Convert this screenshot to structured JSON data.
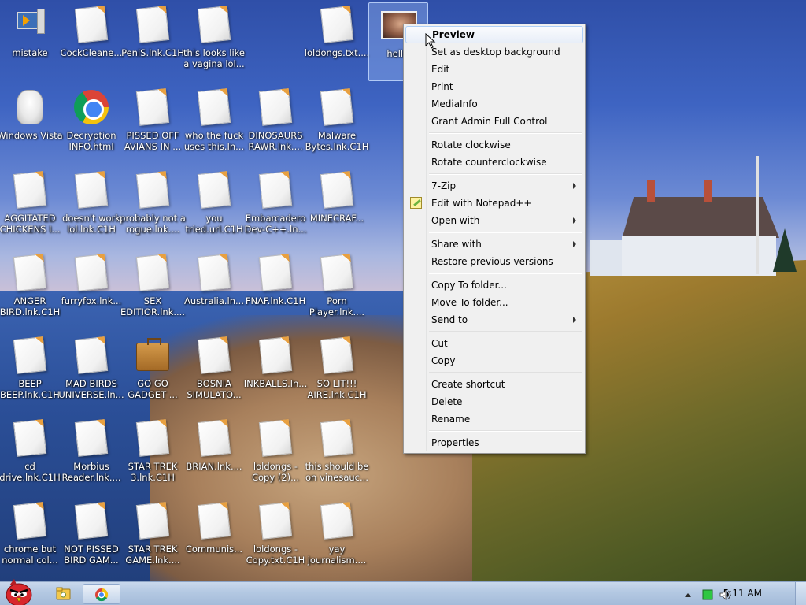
{
  "desktop": {
    "icons": [
      {
        "label": "mistake",
        "icon": "computer-arrow-icon"
      },
      {
        "label": "CockCleane...",
        "icon": "document-icon"
      },
      {
        "label": "PeniS.lnk.C1H",
        "icon": "document-icon"
      },
      {
        "label": "this looks like a vagina lol...",
        "icon": "document-icon"
      },
      {
        "label": "loldongs.txt....",
        "icon": "document-icon"
      },
      {
        "label": "hello.",
        "icon": "photo-icon"
      },
      {
        "label": "Windows Vista",
        "icon": "vista-icon"
      },
      {
        "label": "Decryption INFO.html",
        "icon": "chrome-icon"
      },
      {
        "label": "PISSED OFF AVIANS IN ...",
        "icon": "document-icon"
      },
      {
        "label": "who the fuck uses this.In...",
        "icon": "document-icon"
      },
      {
        "label": "DINOSAURS RAWR.lnk....",
        "icon": "document-icon"
      },
      {
        "label": "Malware Bytes.lnk.C1H",
        "icon": "document-icon"
      },
      {
        "label": "AGGITATED CHICKENS I...",
        "icon": "document-icon"
      },
      {
        "label": "doesn't work lol.lnk.C1H",
        "icon": "document-icon"
      },
      {
        "label": "probably not a rogue.lnk....",
        "icon": "document-icon"
      },
      {
        "label": "you tried.url.C1H",
        "icon": "document-icon"
      },
      {
        "label": "Embarcadero Dev-C++.ln...",
        "icon": "document-icon"
      },
      {
        "label": "MINECRAF...",
        "icon": "document-icon"
      },
      {
        "label": "ANGER BIRD.lnk.C1H",
        "icon": "document-icon"
      },
      {
        "label": "furryfox.lnk...",
        "icon": "document-icon"
      },
      {
        "label": "SEX EDITIOR.lnk....",
        "icon": "document-icon"
      },
      {
        "label": "Australia.ln...",
        "icon": "document-icon"
      },
      {
        "label": "FNAF.lnk.C1H",
        "icon": "document-icon"
      },
      {
        "label": "Porn Player.lnk....",
        "icon": "document-icon"
      },
      {
        "label": "BEEP BEEP.lnk.C1H",
        "icon": "document-icon"
      },
      {
        "label": "MAD BIRDS UNIVERSE.ln...",
        "icon": "document-icon"
      },
      {
        "label": "GO GO GADGET ...",
        "icon": "briefcase-icon"
      },
      {
        "label": "BOSNIA SIMULATO...",
        "icon": "document-icon"
      },
      {
        "label": "INKBALLS.ln...",
        "icon": "document-icon"
      },
      {
        "label": "SO LIT!!! AIRE.lnk.C1H",
        "icon": "document-icon"
      },
      {
        "label": "cd drive.lnk.C1H",
        "icon": "document-icon"
      },
      {
        "label": "Morbius Reader.lnk....",
        "icon": "document-icon"
      },
      {
        "label": "STAR TREK 3.lnk.C1H",
        "icon": "document-icon"
      },
      {
        "label": "BRIAN.lnk....",
        "icon": "document-icon"
      },
      {
        "label": "loldongs - Copy (2)...",
        "icon": "document-icon"
      },
      {
        "label": "this should be on vinesauc...",
        "icon": "document-icon"
      },
      {
        "label": "chrome but normal col...",
        "icon": "document-icon"
      },
      {
        "label": "NOT PISSED BIRD GAM...",
        "icon": "document-icon"
      },
      {
        "label": "STAR TREK GAME.lnk....",
        "icon": "document-icon"
      },
      {
        "label": "Communis...",
        "icon": "document-icon"
      },
      {
        "label": "loldongs - Copy.txt.C1H",
        "icon": "document-icon"
      },
      {
        "label": "yay journalism....",
        "icon": "document-icon"
      }
    ]
  },
  "context_menu": {
    "items": [
      {
        "type": "item",
        "label": "Preview",
        "bold": true,
        "hover": true
      },
      {
        "type": "item",
        "label": "Set as desktop background"
      },
      {
        "type": "item",
        "label": "Edit"
      },
      {
        "type": "item",
        "label": "Print"
      },
      {
        "type": "item",
        "label": "MediaInfo"
      },
      {
        "type": "item",
        "label": "Grant Admin Full Control"
      },
      {
        "type": "sep"
      },
      {
        "type": "item",
        "label": "Rotate clockwise"
      },
      {
        "type": "item",
        "label": "Rotate counterclockwise"
      },
      {
        "type": "sep"
      },
      {
        "type": "item",
        "label": "7-Zip",
        "submenu": true
      },
      {
        "type": "item",
        "label": "Edit with Notepad++",
        "icon": "notepadpp-icon"
      },
      {
        "type": "item",
        "label": "Open with",
        "submenu": true
      },
      {
        "type": "sep"
      },
      {
        "type": "item",
        "label": "Share with",
        "submenu": true
      },
      {
        "type": "item",
        "label": "Restore previous versions"
      },
      {
        "type": "sep"
      },
      {
        "type": "item",
        "label": "Copy To folder..."
      },
      {
        "type": "item",
        "label": "Move To folder..."
      },
      {
        "type": "item",
        "label": "Send to",
        "submenu": true
      },
      {
        "type": "sep"
      },
      {
        "type": "item",
        "label": "Cut"
      },
      {
        "type": "item",
        "label": "Copy"
      },
      {
        "type": "sep"
      },
      {
        "type": "item",
        "label": "Create shortcut"
      },
      {
        "type": "item",
        "label": "Delete"
      },
      {
        "type": "item",
        "label": "Rename"
      },
      {
        "type": "sep"
      },
      {
        "type": "item",
        "label": "Properties"
      }
    ]
  },
  "taskbar": {
    "start_icon": "angry-bird-icon",
    "pinned": [
      {
        "name": "explorer",
        "icon": "folder-icon"
      },
      {
        "name": "chrome",
        "icon": "chrome-icon",
        "active": true
      }
    ],
    "tray": {
      "icons": [
        "show-hidden-icons-icon",
        "battery-icon",
        "volume-icon"
      ],
      "clock": "5:11 AM"
    }
  }
}
